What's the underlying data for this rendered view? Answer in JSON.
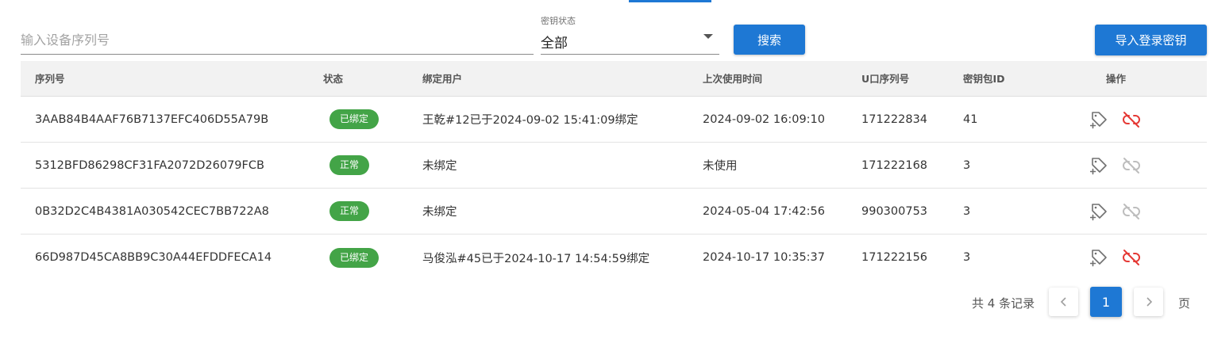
{
  "search": {
    "placeholder": "输入设备序列号",
    "value": ""
  },
  "status_filter": {
    "label": "密钥状态",
    "value": "全部"
  },
  "buttons": {
    "search": "搜索",
    "import": "导入登录密钥"
  },
  "columns": [
    "序列号",
    "状态",
    "绑定用户",
    "上次使用时间",
    "U口序列号",
    "密钥包ID",
    "操作"
  ],
  "rows": [
    {
      "serial": "3AAB84B4AAF76B7137EFC406D55A79B",
      "status": "已绑定",
      "bound_user": "王乾#12已于2024-09-02 15:41:09绑定",
      "last_used": "2024-09-02 16:09:10",
      "u_serial": "171222834",
      "package_id": "41",
      "unbind_enabled": true
    },
    {
      "serial": "5312BFD86298CF31FA2072D26079FCB",
      "status": "正常",
      "bound_user": "未绑定",
      "last_used": "未使用",
      "u_serial": "171222168",
      "package_id": "3",
      "unbind_enabled": false
    },
    {
      "serial": "0B32D2C4B4381A030542CEC7BB722A8",
      "status": "正常",
      "bound_user": "未绑定",
      "last_used": "2024-05-04 17:42:56",
      "u_serial": "990300753",
      "package_id": "3",
      "unbind_enabled": false
    },
    {
      "serial": "66D987D45CA8BB9C30A44EFDDFECA14",
      "status": "已绑定",
      "bound_user": "马俊泓#45已于2024-10-17 14:54:59绑定",
      "last_used": "2024-10-17 10:35:37",
      "u_serial": "171222156",
      "package_id": "3",
      "unbind_enabled": true
    }
  ],
  "pagination": {
    "total_text": "共 4 条记录",
    "current_page": "1",
    "suffix": "页"
  },
  "colors": {
    "primary": "#1e78d4",
    "badge": "#43a447",
    "unbind_active": "#e53935",
    "unbind_disabled": "#bdbdbd",
    "icon": "#707070"
  },
  "icons": {
    "action_tag": "tag-plus-icon",
    "action_unbind": "link-off-icon",
    "prev": "chevron-left-icon",
    "next": "chevron-right-icon",
    "caret": "caret-down-icon"
  }
}
